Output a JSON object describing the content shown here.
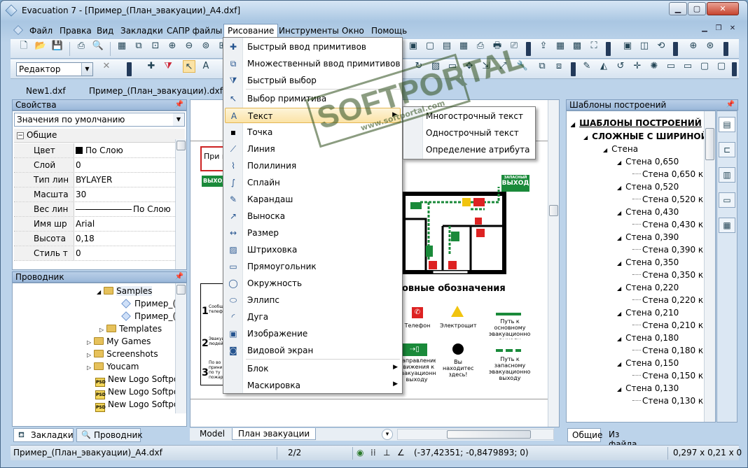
{
  "window": {
    "title": "Evacuation 7 - [Пример_(План_эвакуации)_A4.dxf]"
  },
  "menubar": {
    "items": [
      "Файл",
      "Правка",
      "Вид",
      "Закладки",
      "САПР файлы",
      "Рисование",
      "Инструменты",
      "Окно",
      "Помощь"
    ],
    "open": "Рисование"
  },
  "toolbar": {
    "mode_combo": "Редактор"
  },
  "doc_tabs": [
    "New1.dxf",
    "Пример_(План_эвакуации).dxf"
  ],
  "properties": {
    "title": "Свойства",
    "combo": "Значения по умолчанию",
    "group": "Общие",
    "rows": [
      {
        "key": "Цвет",
        "value": "По Слою"
      },
      {
        "key": "Слой",
        "value": "0"
      },
      {
        "key": "Тип лин",
        "value": "BYLAYER"
      },
      {
        "key": "Масшта",
        "value": "30"
      },
      {
        "key": "Вес лин",
        "value": "По Слою"
      },
      {
        "key": "Имя шр",
        "value": "Arial"
      },
      {
        "key": "Высота",
        "value": "0,18"
      },
      {
        "key": "Стиль т",
        "value": "0"
      }
    ]
  },
  "explorer": {
    "title": "Проводник",
    "items": [
      {
        "label": "Samples",
        "type": "folder"
      },
      {
        "label": "Пример_(",
        "type": "cube"
      },
      {
        "label": "Пример_(",
        "type": "cube"
      },
      {
        "label": "Templates",
        "type": "folder"
      },
      {
        "label": "My Games",
        "type": "folder"
      },
      {
        "label": "Screenshots",
        "type": "folder"
      },
      {
        "label": "Youcam",
        "type": "folder"
      },
      {
        "label": "New Logo Softpo",
        "type": "psd"
      },
      {
        "label": "New Logo Softpo",
        "type": "psd"
      },
      {
        "label": "New Logo Softpo",
        "type": "psd"
      }
    ],
    "bottom_tabs": [
      "Закладки",
      "Проводник"
    ]
  },
  "drawing_menu": {
    "items": [
      {
        "label": "Быстрый ввод примитивов",
        "icon": "plus-icon"
      },
      {
        "label": "Множественный ввод примитивов",
        "icon": "multi-select-icon"
      },
      {
        "label": "Быстрый выбор",
        "icon": "funnel-icon"
      },
      {
        "label": "Выбор примитива",
        "icon": "cursor-icon"
      },
      {
        "label": "Текст",
        "icon": "text-icon",
        "submenu": true
      },
      {
        "label": "Точка",
        "icon": "point-icon"
      },
      {
        "label": "Линия",
        "icon": "line-icon"
      },
      {
        "label": "Полилиния",
        "icon": "polyline-icon"
      },
      {
        "label": "Сплайн",
        "icon": "spline-icon"
      },
      {
        "label": "Карандаш",
        "icon": "pencil-icon"
      },
      {
        "label": "Выноска",
        "icon": "leader-icon"
      },
      {
        "label": "Размер",
        "icon": "dimension-icon"
      },
      {
        "label": "Штриховка",
        "icon": "hatch-icon"
      },
      {
        "label": "Прямоугольник",
        "icon": "rectangle-icon"
      },
      {
        "label": "Окружность",
        "icon": "circle-icon"
      },
      {
        "label": "Эллипс",
        "icon": "ellipse-icon"
      },
      {
        "label": "Дуга",
        "icon": "arc-icon"
      },
      {
        "label": "Изображение",
        "icon": "image-icon"
      },
      {
        "label": "Видовой экран",
        "icon": "viewport-icon"
      },
      {
        "label": "Блок",
        "icon": "",
        "submenu": true
      },
      {
        "label": "Маскировка",
        "icon": "",
        "submenu": true
      }
    ]
  },
  "text_submenu": [
    "Многострочный текст",
    "Однострочный текст",
    "Определение атрибута"
  ],
  "drawing": {
    "label_box": "При п",
    "exit_left": "ВЫХОД",
    "exit_right": "ВЫХОД",
    "exit_right_small": "ЗАПАСНЫЙ",
    "legend_title": "Условные обозначения",
    "legend_title_visible": "овные обозначения",
    "legend": {
      "phone": "Телефон",
      "electro": "Электрощит",
      "path_main": "Путь к основному эвакуационному выходу",
      "direction": "Направление движения к эвакуационному выходу",
      "you_are_here": "Вы находитесь здесь!",
      "path_spare": "Путь к запасному эвакуационному выходу"
    },
    "steps": [
      "1",
      "2",
      "3"
    ],
    "step_texts": [
      "Сообщ телеф",
      "Эвакуи людей",
      "По во прини по ту пожар"
    ],
    "layout_tabs": [
      "Model",
      "План эвакуации"
    ]
  },
  "templates": {
    "title": "Шаблоны построений",
    "root": "ШАБЛОНЫ ПОСТРОЕНИЙ",
    "group": "СЛОЖНЫЕ С ШИРИНОЙ",
    "node": "Стена",
    "items": [
      {
        "name": "Стена 0,650",
        "child": "Стена 0,650 кр"
      },
      {
        "name": "Стена 0,520",
        "child": "Стена 0,520 кр"
      },
      {
        "name": "Стена 0,430",
        "child": "Стена 0,430 кр"
      },
      {
        "name": "Стена 0,390",
        "child": "Стена 0,390 кр"
      },
      {
        "name": "Стена 0,350",
        "child": "Стена 0,350 кр"
      },
      {
        "name": "Стена 0,220",
        "child": "Стена 0,220 кр"
      },
      {
        "name": "Стена 0,210",
        "child": "Стена 0,210 кр"
      },
      {
        "name": "Стена 0,180",
        "child": "Стена 0,180 кр"
      },
      {
        "name": "Стена 0,150",
        "child": "Стена 0,150 кр"
      },
      {
        "name": "Стена 0,130",
        "child": "Стена 0,130 кр"
      }
    ],
    "bottom_tabs": [
      "Общие",
      "Из файла"
    ]
  },
  "statusbar": {
    "file": "Пример_(План_эвакуации)_A4.dxf",
    "pages": "2/2",
    "coords": "(-37,42351; -0,8479893; 0)",
    "size": "0,297 x 0,21 x 0"
  },
  "watermark": {
    "text": "SOFTPORTAL",
    "url": "www.softportal.com"
  },
  "colors": {
    "accent": "#2a5a96",
    "exit_green": "#1a8a3a",
    "highlight": "#fbe3a6"
  }
}
